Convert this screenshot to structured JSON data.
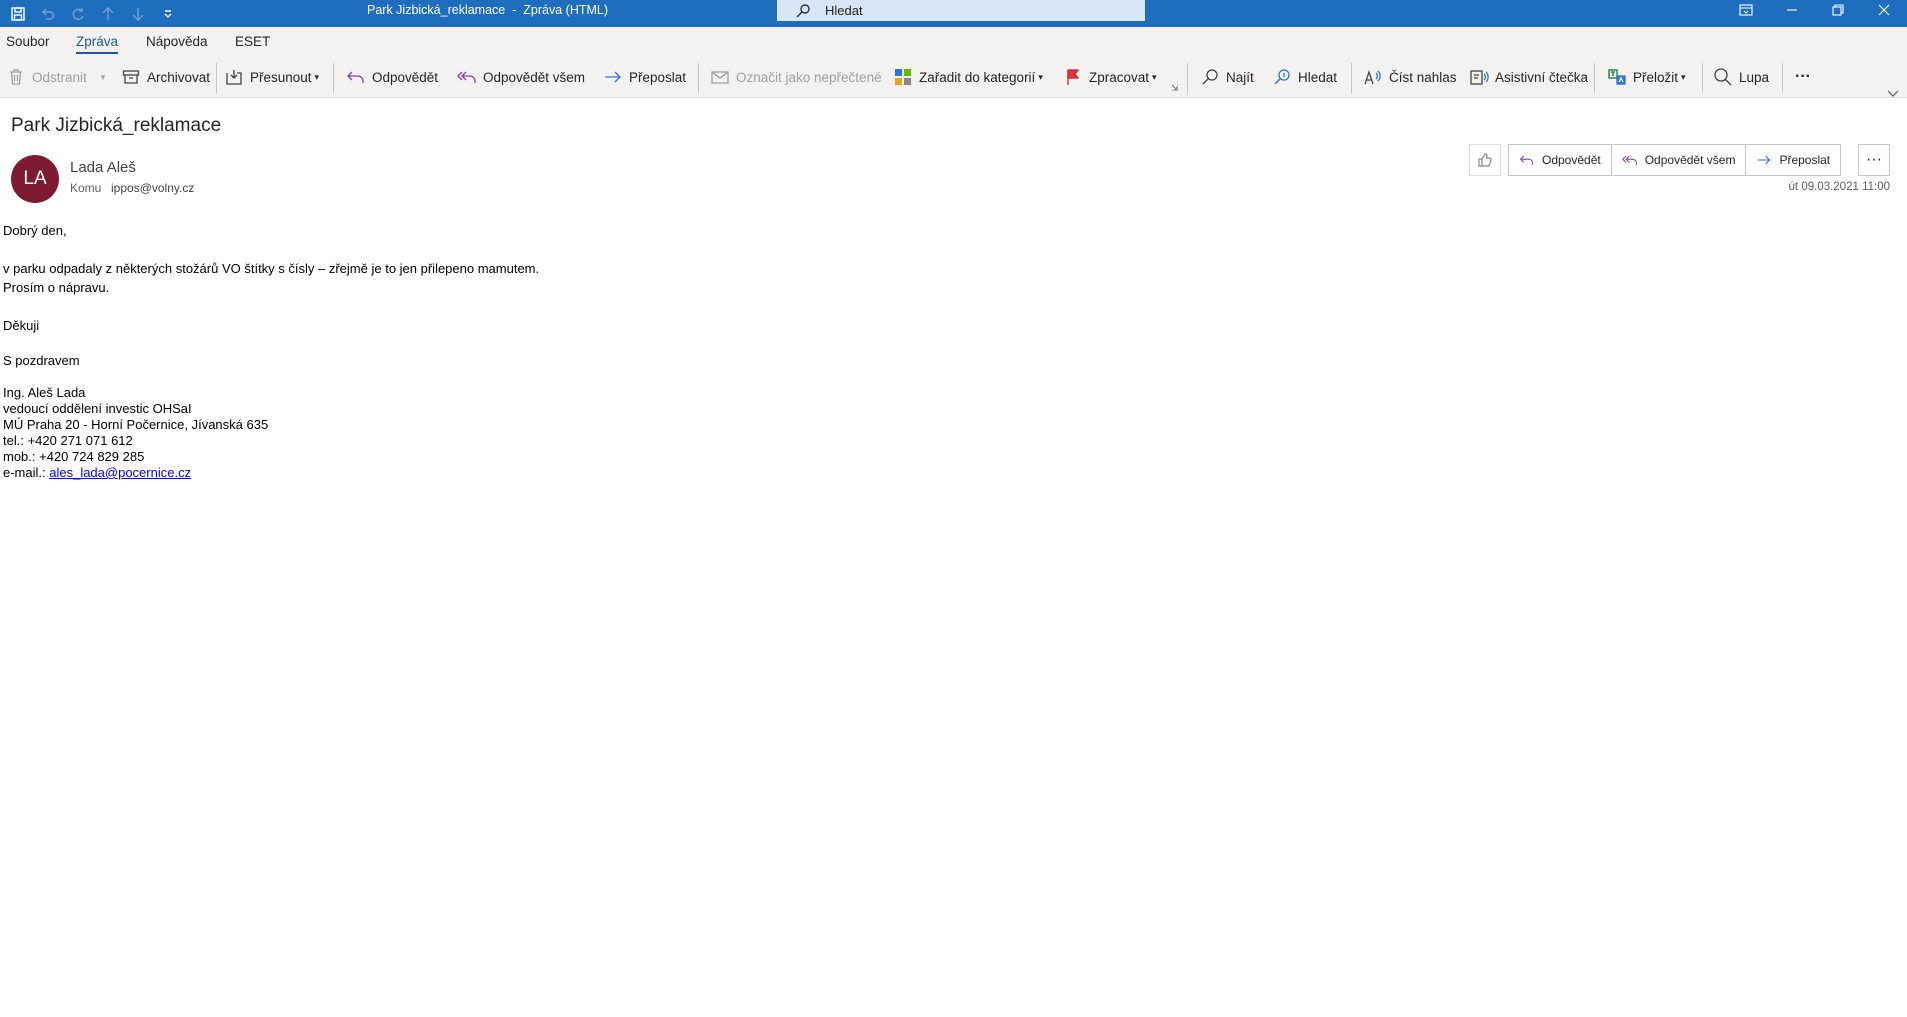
{
  "window": {
    "title": "Park Jizbická_reklamace  -  Zpráva (HTML)",
    "search_placeholder": "Hledat",
    "accent": "#1f6ebd"
  },
  "tabs": [
    {
      "label": "Soubor"
    },
    {
      "label": "Zpráva",
      "active": true
    },
    {
      "label": "Nápověda"
    },
    {
      "label": "ESET"
    }
  ],
  "ribbon": {
    "delete": "Odstranit",
    "archive": "Archivovat",
    "move": "Přesunout",
    "reply": "Odpovědět",
    "reply_all": "Odpovědět všem",
    "forward": "Přeposlat",
    "mark_unread": "Označit jako nepřečtené",
    "categorize": "Zařadit do kategorií",
    "followup": "Zpracovat",
    "find": "Najít",
    "search": "Hledat",
    "read_aloud": "Číst nahlas",
    "immersive_reader": "Asistivní čtečka",
    "translate": "Přeložit",
    "zoom": "Lupa",
    "more": "···"
  },
  "message": {
    "subject": "Park Jizbická_reklamace",
    "avatar_initials": "LA",
    "avatar_color": "#7e1b30",
    "sender": "Lada Aleš",
    "to_label": "Komu",
    "to": "ippos@volny.cz",
    "date": "út 09.03.2021 11:00",
    "actions": {
      "reply": "Odpovědět",
      "reply_all": "Odpovědět všem",
      "forward": "Přeposlat",
      "more": "···"
    }
  },
  "body": {
    "greeting": "Dobrý den,",
    "line1": "v parku odpadaly z některých stožárů VO štítky s čísly – zřejmě je to jen přilepeno mamutem.",
    "line2": "Prosím o nápravu.",
    "thanks": "Děkuji",
    "regards": "S pozdravem",
    "sig_name": "Ing. Aleš Lada",
    "sig_role": "vedoucí oddělení investic OHSaI",
    "sig_org": "MÚ Praha 20 - Horní Počernice, Jívanská 635",
    "sig_tel": "tel.: +420 271 071 612",
    "sig_mob": "mob.: +420 724 829 285",
    "sig_email_label": "e-mail.: ",
    "sig_email": "ales_lada@pocernice.cz"
  }
}
